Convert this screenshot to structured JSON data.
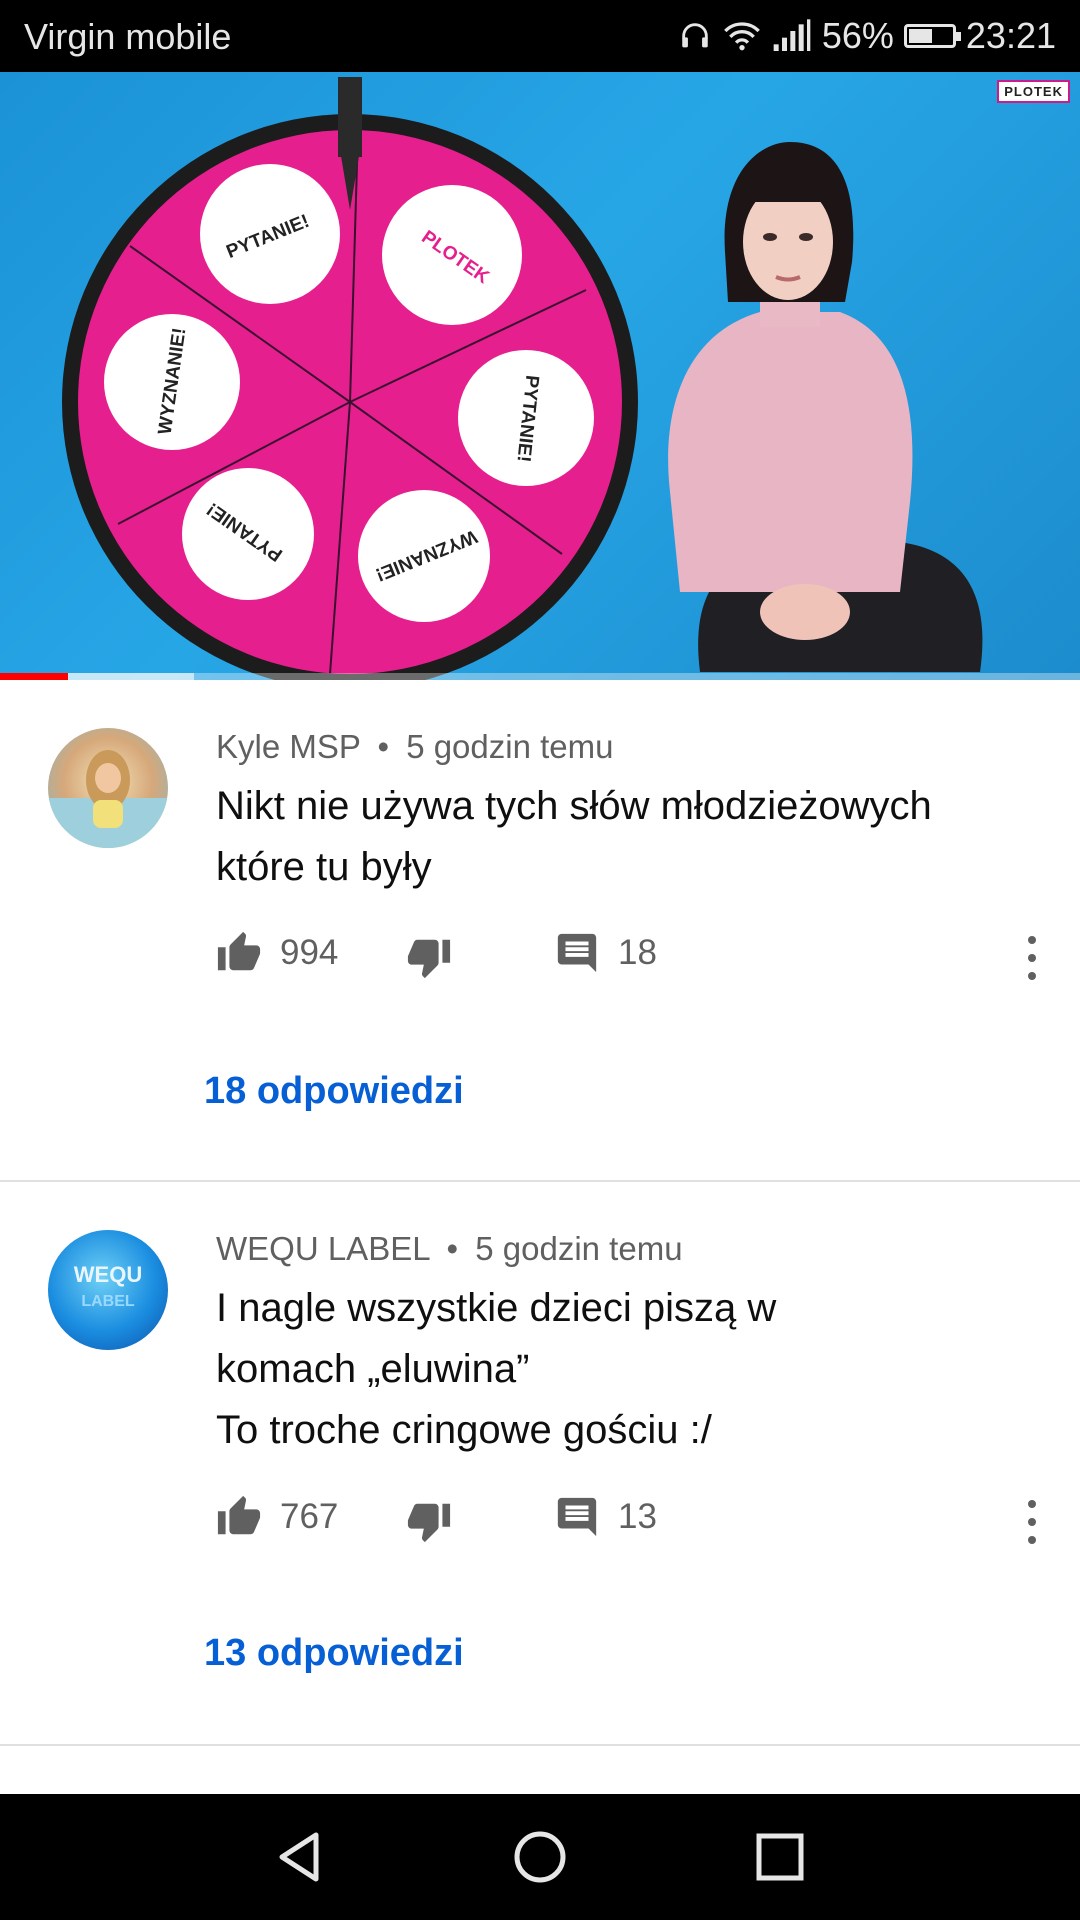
{
  "status_bar": {
    "carrier": "Virgin mobile",
    "battery_percent": "56%",
    "battery_level": 0.56,
    "time": "23:21",
    "icons": [
      "headphones-icon",
      "wifi-icon",
      "signal-icon",
      "battery-icon"
    ]
  },
  "video": {
    "logo_text": "PLOTEK",
    "wheel_labels": [
      "PYTANIE!",
      "PLOTEK",
      "PYTANIE!",
      "WYZNANIE!",
      "PYTANIE!",
      "WYZNANIE!"
    ],
    "progress_played": 0.063,
    "progress_buffered": 0.18,
    "colors": {
      "background": "#1e97d9",
      "wheel": "#e61f8e"
    }
  },
  "comments": [
    {
      "author": "Kyle MSP",
      "separator": "•",
      "time": "5 godzin temu",
      "text_lines": [
        "Nikt nie używa tych słów młodzieżowych",
        "które tu były"
      ],
      "likes": "994",
      "reply_count": "18",
      "replies_link": "18 odpowiedzi"
    },
    {
      "author": "WEQU LABEL",
      "separator": "•",
      "time": "5 godzin temu",
      "text_lines": [
        "I nagle wszystkie dzieci piszą w",
        "komach „eluwina”",
        "To troche cringowe gościu :/"
      ],
      "likes": "767",
      "reply_count": "13",
      "replies_link": "13 odpowiedzi",
      "avatar_text": [
        "WEQU",
        "LABEL"
      ]
    }
  ],
  "nav_bar": {
    "buttons": [
      "back-icon",
      "home-icon",
      "recents-icon"
    ]
  },
  "colors": {
    "link": "#065fd4",
    "secondary_text": "#606060",
    "progress_red": "#ff0000"
  }
}
